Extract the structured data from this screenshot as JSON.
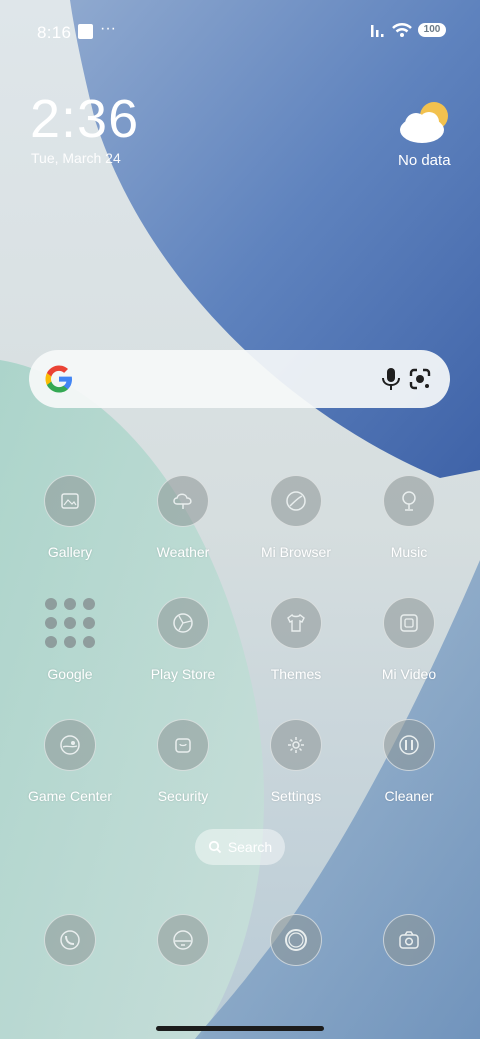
{
  "status": {
    "time": "8:16",
    "more": "···",
    "battery": "100"
  },
  "clock": {
    "time": "2:36",
    "date": "Tue, March 24"
  },
  "weather": {
    "label": "No data"
  },
  "search_widget": {
    "icons": [
      "google-g-icon",
      "mic-icon",
      "lens-icon"
    ]
  },
  "apps": {
    "row1": [
      {
        "label": "Gallery"
      },
      {
        "label": "Weather"
      },
      {
        "label": "Mi Browser"
      },
      {
        "label": "Music"
      }
    ],
    "row2": [
      {
        "label": "Google"
      },
      {
        "label": "Play Store"
      },
      {
        "label": "Themes"
      },
      {
        "label": "Mi Video"
      }
    ],
    "row3": [
      {
        "label": "Game Center"
      },
      {
        "label": "Security"
      },
      {
        "label": "Settings"
      },
      {
        "label": "Cleaner"
      }
    ]
  },
  "app_search": {
    "label": "Search"
  },
  "dock": [
    "phone-icon",
    "messages-icon",
    "browser-icon",
    "camera-icon"
  ]
}
